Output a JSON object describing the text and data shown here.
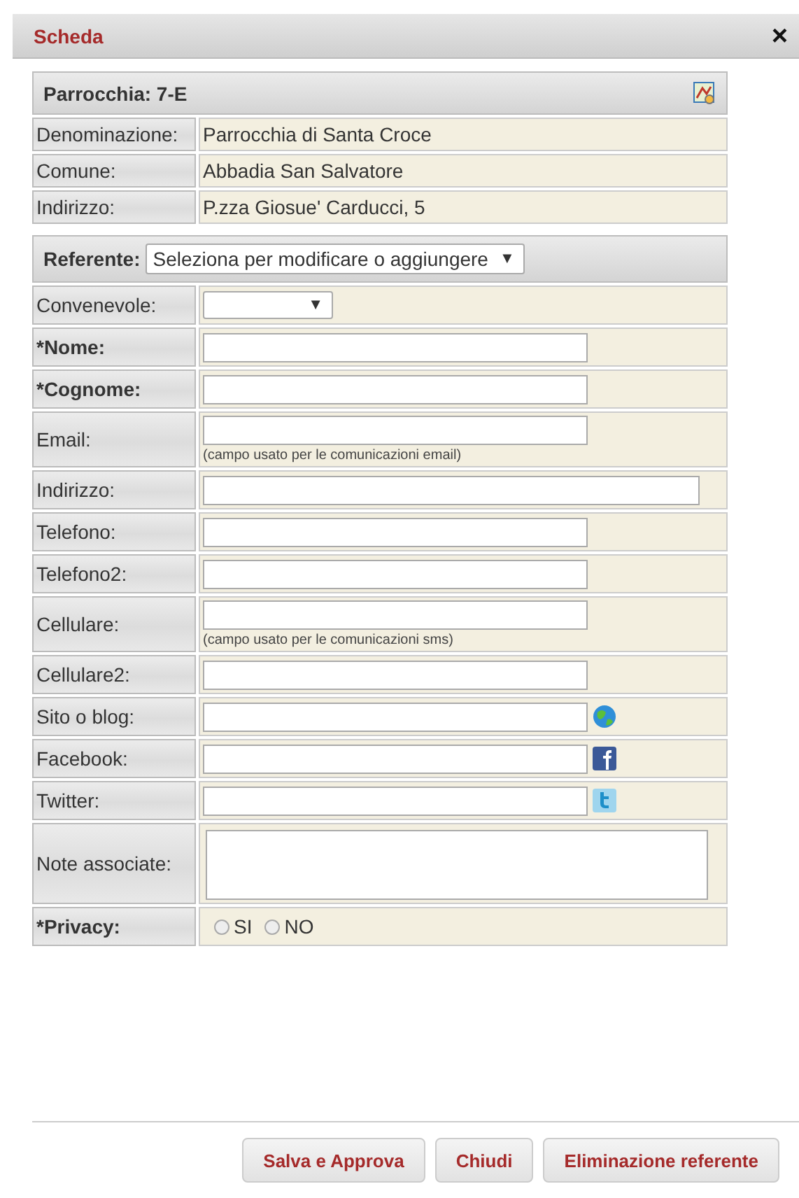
{
  "window": {
    "title": "Scheda",
    "close": "×"
  },
  "parish": {
    "title": "Parrocchia: 7-E",
    "info": [
      {
        "label": "Denominazione:",
        "value": "Parrocchia di Santa Croce"
      },
      {
        "label": "Comune:",
        "value": "Abbadia San Salvatore"
      },
      {
        "label": "Indirizzo:",
        "value": "P.zza Giosue' Carducci, 5"
      }
    ]
  },
  "referente": {
    "label": "Referente:",
    "select": "Seleziona per modificare o aggiungere",
    "arrow": "▼"
  },
  "fields": [
    {
      "kind": "select",
      "label": "Convenevole:",
      "required": false,
      "arrow": "▼"
    },
    {
      "kind": "text",
      "label": "*Nome:",
      "required": true
    },
    {
      "kind": "text",
      "label": "*Cognome:",
      "required": true
    },
    {
      "kind": "text",
      "label": "Email:",
      "required": false,
      "hint": "(campo usato per le comunicazioni email)"
    },
    {
      "kind": "wide",
      "label": "Indirizzo:",
      "required": false
    },
    {
      "kind": "text",
      "label": "Telefono:",
      "required": false
    },
    {
      "kind": "text",
      "label": "Telefono2:",
      "required": false
    },
    {
      "kind": "text",
      "label": "Cellulare:",
      "required": false,
      "hint": "(campo usato per le comunicazioni sms)"
    },
    {
      "kind": "text",
      "label": "Cellulare2:",
      "required": false
    },
    {
      "kind": "web",
      "label": "Sito o blog:",
      "required": false
    },
    {
      "kind": "facebook",
      "label": "Facebook:",
      "required": false
    },
    {
      "kind": "twitter",
      "label": "Twitter:",
      "required": false
    },
    {
      "kind": "textarea",
      "label": "Note associate:",
      "required": false
    },
    {
      "kind": "radio",
      "label": "*Privacy:",
      "required": true,
      "options": [
        {
          "label": "SI",
          "selected": false
        },
        {
          "label": "NO",
          "selected": false
        }
      ]
    }
  ],
  "buttons": [
    "Salva e Approva",
    "Chiudi",
    "Eliminazione referente"
  ]
}
